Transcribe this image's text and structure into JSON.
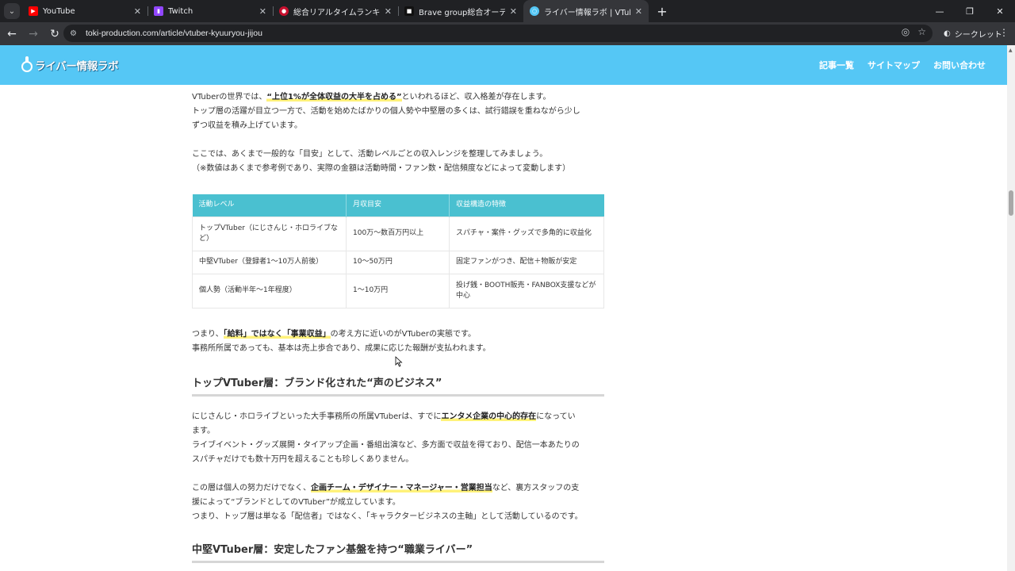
{
  "browser": {
    "tabs": [
      {
        "title": "YouTube",
        "favicon": "youtube-icon",
        "color": "#ff0000"
      },
      {
        "title": "Twitch",
        "favicon": "twitch-icon",
        "color": "#9146ff"
      },
      {
        "title": "総合リアルタイムランキング | 配信者",
        "favicon": "ranking-icon",
        "color": "#c8102e"
      },
      {
        "title": "Brave group総合オーディションフォ",
        "favicon": "brave-icon",
        "color": "#111111"
      },
      {
        "title": "ライバー情報ラボ | VTuber給料事情",
        "favicon": "lab-icon",
        "color": "#55c7f5"
      }
    ],
    "url_host": "toki-production.com",
    "url_path": "/article/vtuber-kyuuryou-jijou",
    "incognito_label": "シークレット"
  },
  "site": {
    "logo_text": "ライバー情報ラボ",
    "nav": [
      "記事一覧",
      "サイトマップ",
      "お問い合わせ"
    ],
    "brand_color": "#55c7f5"
  },
  "article": {
    "p1_pre": "VTuberの世界では、",
    "p1_mark": "“上位1%が全体収益の大半を占める”",
    "p1_post": "といわれるほど、収入格差が存在します。",
    "p2_line1": "トップ層の活躍が目立つ一方で、活動を始めたばかりの個人勢や中堅層の多くは、試行錯誤を重ねながら少し",
    "p2_line2": "ずつ収益を積み上げています。",
    "p3_line1": "ここでは、あくまで一般的な「目安」として、活動レベルごとの収入レンジを整理してみましょう。",
    "p3_line2": "（※数値はあくまで参考例であり、実際の金額は活動時間・ファン数・配信頻度などによって変動します）",
    "table": {
      "headers": [
        "活動レベル",
        "月収目安",
        "収益構造の特徴"
      ],
      "rows": [
        [
          "トップVTuber（にじさんじ・ホロライブなど）",
          "100万〜数百万円以上",
          "スパチャ・案件・グッズで多角的に収益化"
        ],
        [
          "中堅VTuber（登録者1〜10万人前後）",
          "10〜50万円",
          "固定ファンがつき、配信＋物販が安定"
        ],
        [
          "個人勢（活動半年〜1年程度）",
          "1〜10万円",
          "投げ銭・BOOTH販売・FANBOX支援などが中心"
        ]
      ]
    },
    "p4_pre": "つまり、",
    "p4_mark": "「給料」ではなく「事業収益」",
    "p4_post": "の考え方に近いのがVTuberの実態です。",
    "p4_line2": "事務所所属であっても、基本は売上歩合であり、成果に応じた報酬が支払われます。",
    "h2_top": "トップVTuber層：ブランド化された“声のビジネス”",
    "p5_pre": "にじさんじ・ホロライブといった大手事務所の所属VTuberは、すでに",
    "p5_mark": "エンタメ企業の中心的存在",
    "p5_post": "になってい",
    "p5_line2": "ます。",
    "p6_line1": "ライブイベント・グッズ展開・タイアップ企画・番組出演など、多方面で収益を得ており、配信一本あたりの",
    "p6_line2": "スパチャだけでも数十万円を超えることも珍しくありません。",
    "p7_pre": "この層は個人の努力だけでなく、",
    "p7_mark": "企画チーム・デザイナー・マネージャー・営業担当",
    "p7_post": "など、裏方スタッフの支",
    "p7_line2": "援によって“ブランドとしてのVTuber”が成立しています。",
    "p7_line3": "つまり、トップ層は単なる「配信者」ではなく、「キャラクタービジネスの主軸」として活動しているのです。",
    "h2_mid": "中堅VTuber層：安定したファン基盤を持つ“職業ライバー”"
  }
}
